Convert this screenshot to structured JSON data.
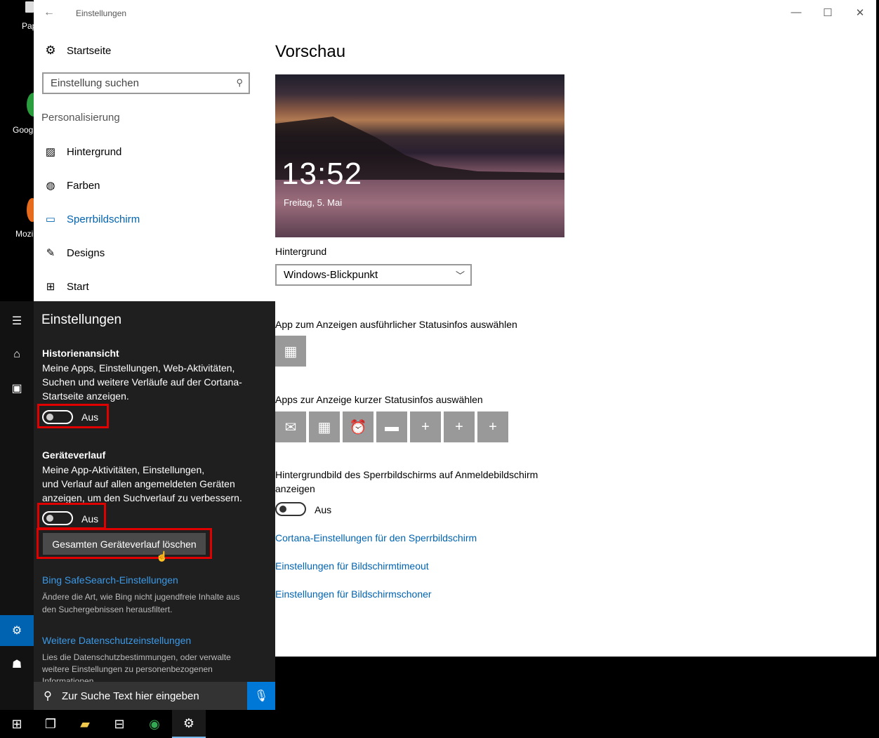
{
  "desktop": {
    "icons": [
      {
        "label": "Pap"
      },
      {
        "label": "Goog"
      },
      {
        "label": "Mozi"
      }
    ]
  },
  "window": {
    "title": "Einstellungen",
    "back_icon": "back-arrow-icon",
    "controls": [
      "minimize",
      "maximize",
      "close"
    ]
  },
  "sidebar": {
    "home_label": "Startseite",
    "search_placeholder": "Einstellung suchen",
    "section": "Personalisierung",
    "items": [
      {
        "label": "Hintergrund",
        "icon": "image-icon"
      },
      {
        "label": "Farben",
        "icon": "palette-icon"
      },
      {
        "label": "Sperrbildschirm",
        "icon": "lockscreen-icon",
        "active": true
      },
      {
        "label": "Designs",
        "icon": "brush-icon"
      },
      {
        "label": "Start",
        "icon": "start-grid-icon"
      }
    ]
  },
  "main": {
    "heading": "Vorschau",
    "preview": {
      "time": "13:52",
      "date": "Freitag, 5. Mai"
    },
    "background_label": "Hintergrund",
    "background_value": "Windows-Blickpunkt",
    "detailed_status_label": "App zum Anzeigen ausführlicher Statusinfos auswählen",
    "quick_status_label": "Apps zur Anzeige kurzer Statusinfos auswählen",
    "quick_tiles": [
      "mail-icon",
      "calendar-icon",
      "alarm-icon",
      "message-icon",
      "plus-icon",
      "plus-icon",
      "plus-icon"
    ],
    "signin_label_1": "Hintergrundbild des Sperrbildschirms auf Anmeldebildschirm",
    "signin_label_2": "anzeigen",
    "signin_toggle": "Aus",
    "links": [
      "Cortana-Einstellungen für den Sperrbildschirm",
      "Einstellungen für Bildschirmtimeout",
      "Einstellungen für Bildschirmschoner"
    ]
  },
  "cortana": {
    "title": "Einstellungen",
    "history_heading": "Historienansicht",
    "history_text_1": "Meine Apps, Einstellungen, Web-Aktivitäten,",
    "history_text_2": "Suchen und weitere Verläufe auf der Cortana-",
    "history_text_3": "Startseite anzeigen.",
    "history_toggle": "Aus",
    "device_heading": "Geräteverlauf",
    "device_text_1": "Meine App-Aktivitäten, Einstellungen,",
    "device_text_2": "und Verlauf auf allen angemeldeten Geräten",
    "device_text_3": "anzeigen, um den Suchverlauf zu verbessern.",
    "device_toggle": "Aus",
    "clear_button": "Gesamten Geräteverlauf löschen",
    "bing_link": "Bing SafeSearch-Einstellungen",
    "bing_desc_1": "Ändere die Art, wie Bing nicht jugendfreie Inhalte aus",
    "bing_desc_2": "den Suchergebnissen herausfiltert.",
    "privacy_link": "Weitere Datenschutzeinstellungen",
    "privacy_desc_1": "Lies die Datenschutzbestimmungen, oder verwalte",
    "privacy_desc_2": "weitere Einstellungen zu personenbezogenen",
    "privacy_desc_3": "Informationen",
    "search_placeholder": "Zur Suche Text hier eingeben"
  },
  "taskbar": {
    "items": [
      "windows-start-icon",
      "task-view-icon",
      "file-explorer-icon",
      "store-icon",
      "chrome-icon",
      "settings-icon"
    ]
  },
  "colors": {
    "accent": "#0063b1",
    "highlight_box": "#e00000",
    "cortana_bg": "#1f1f1f"
  }
}
